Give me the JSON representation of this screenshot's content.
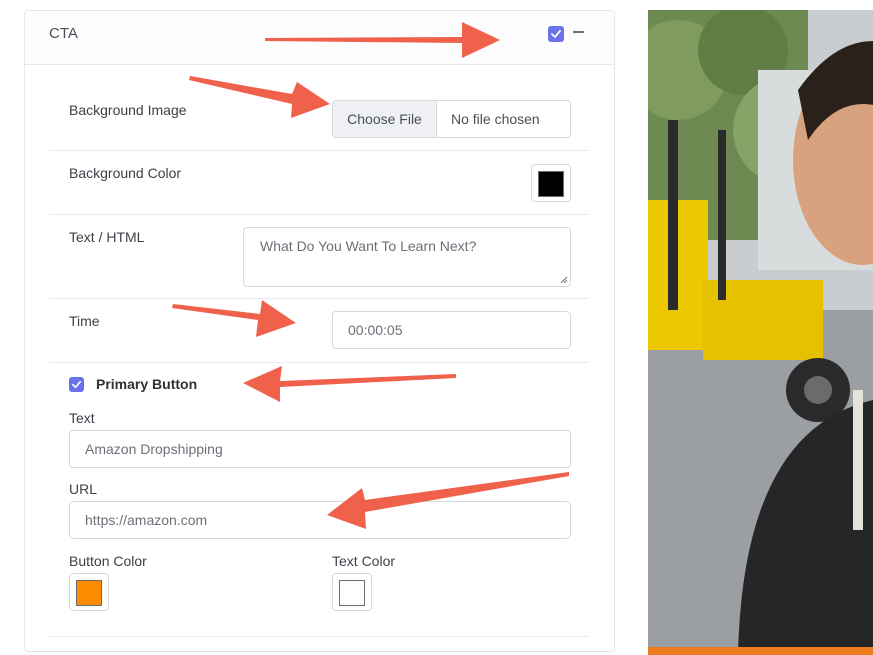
{
  "panel": {
    "title": "CTA",
    "enabled": true
  },
  "fields": {
    "background_image": {
      "label": "Background Image",
      "button_label": "Choose File",
      "status": "No file chosen"
    },
    "background_color": {
      "label": "Background Color",
      "value": "#000000"
    },
    "text_html": {
      "label": "Text / HTML",
      "placeholder": "What Do You Want To Learn Next?"
    },
    "time": {
      "label": "Time",
      "value": "00:00:05"
    }
  },
  "primary_button": {
    "label": "Primary Button",
    "checked": true,
    "text_label": "Text",
    "text_placeholder": "Amazon Dropshipping",
    "url_label": "URL",
    "url_placeholder": "https://amazon.com",
    "button_color_label": "Button Color",
    "button_color": "#ff8c00",
    "text_color_label": "Text Color",
    "text_color": "#ffffff"
  },
  "colors": {
    "accent": "#6b72e8",
    "annotation_arrow": "#f0614c"
  }
}
